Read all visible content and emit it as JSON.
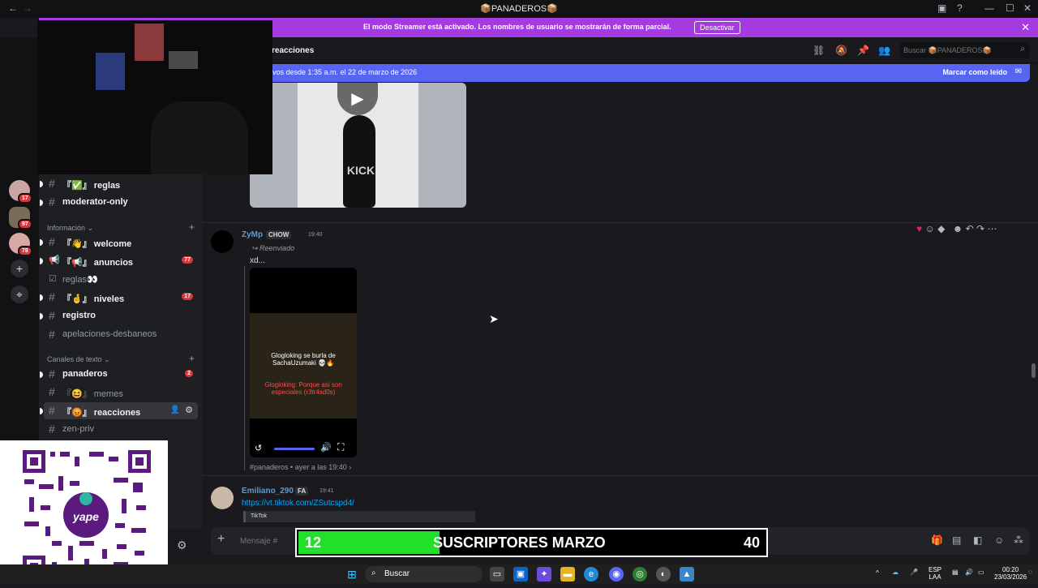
{
  "window": {
    "title": "📦PANADEROS📦",
    "back": "←",
    "forward": "→",
    "minimize": "—",
    "maximize": "☐",
    "close": "✕"
  },
  "banner": {
    "message": "El modo Streamer está activado. Los nombres de usuario se mostrarán de forma parcial.",
    "button": "Desactivar",
    "close": "✕"
  },
  "servers": [
    {
      "badge": "17"
    },
    {
      "badge": "97"
    },
    {
      "badge": "78"
    }
  ],
  "sidebar": {
    "channels_top": [
      {
        "prefix": "『✅』",
        "name": "reglas",
        "bold": true
      },
      {
        "prefix": "",
        "name": "moderator-only",
        "bold": true
      }
    ],
    "category_info": "Información",
    "channels_info": [
      {
        "icon": "#",
        "prefix": "『👋』",
        "name": "welcome",
        "bold": true,
        "count": ""
      },
      {
        "icon": "📢",
        "prefix": "『📢』",
        "name": "anuncios",
        "bold": true,
        "count": "77"
      },
      {
        "icon": "☑",
        "prefix": "",
        "name": "reglas👀",
        "bold": false,
        "count": ""
      },
      {
        "icon": "#",
        "prefix": "『🤞』",
        "name": "niveles",
        "bold": true,
        "count": "17"
      },
      {
        "icon": "#",
        "prefix": "",
        "name": "registro",
        "bold": true,
        "count": ""
      },
      {
        "icon": "#",
        "prefix": "",
        "name": "apelaciones-desbaneos",
        "bold": false,
        "count": ""
      }
    ],
    "category_text": "Canales de texto",
    "channels_text": [
      {
        "prefix": "",
        "name": "panaderos",
        "bold": true,
        "count": "2",
        "active": false
      },
      {
        "prefix": "『😆』",
        "name": "memes",
        "bold": false,
        "count": "",
        "active": false
      },
      {
        "prefix": "『😡』",
        "name": "reacciones",
        "bold": true,
        "count": "",
        "active": true
      },
      {
        "prefix": "",
        "name": "zen-priv",
        "bold": false,
        "count": "",
        "active": false
      }
    ]
  },
  "header": {
    "channel": "reacciones",
    "search_placeholder": "Buscar 📦PANADEROS📦"
  },
  "newbar": {
    "text": "vos desde 1:35 a.m. el 22 de marzo de 2026",
    "mark": "Marcar como leído"
  },
  "messages": [
    {
      "author": "ZyMp",
      "tag": "CHOW",
      "time": "19:40",
      "forwarded": "Reenviado",
      "text": "xd...",
      "video_caption_1": "Glogloking se burla de SachaUzumaki 💀🔥",
      "video_caption_2": "Glogloking: Porque asi son especiales (r3tr4sd0s)",
      "footer": "#panaderos  •  ayer a las 19:40  ›",
      "preview_watermark": "KICK",
      "author_color": "#5b9bd5"
    },
    {
      "author": "Emiliano_290",
      "tag": "FA",
      "time": "19:41",
      "link": "https://vt.tiktok.com/ZSutcspd4/",
      "embed_label": "TikTok",
      "author_color": "#5b9bd5"
    }
  ],
  "composer": {
    "placeholder": "Mensaje #"
  },
  "subgoal": {
    "current": "12",
    "label": "SUSCRIPTORES MARZO",
    "goal": "40",
    "progress": 0.3
  },
  "qr": {
    "brand": "yape"
  },
  "taskbar": {
    "search": "Buscar",
    "lang_1": "ESP",
    "lang_2": "LAA",
    "time": "00:20",
    "date": "23/03/2026"
  }
}
